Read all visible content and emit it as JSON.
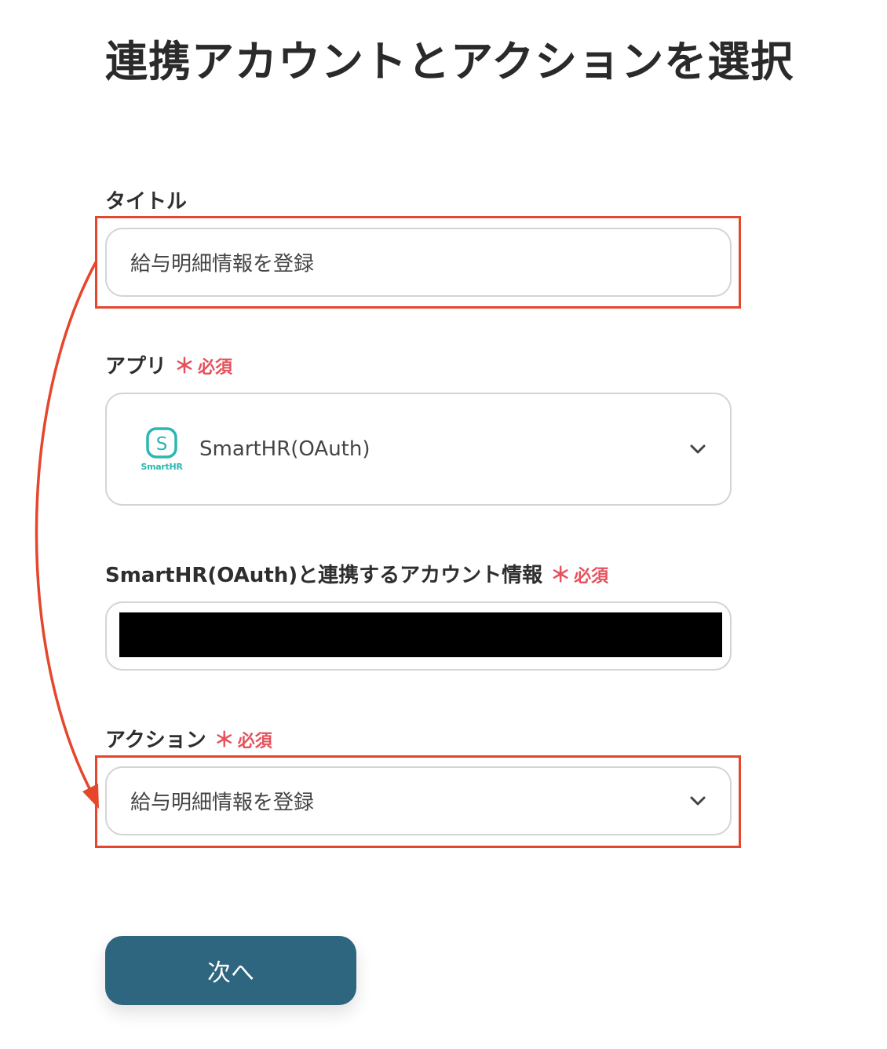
{
  "page": {
    "title": "連携アカウントとアクションを選択"
  },
  "required_marker": {
    "star": "＊",
    "text": "必須"
  },
  "form": {
    "title_field": {
      "label": "タイトル",
      "value": "給与明細情報を登録"
    },
    "app_field": {
      "label": "アプリ",
      "value": "SmartHR(OAuth)",
      "logo_text": "SmartHR",
      "logo_glyph": "S",
      "logo_icon": "smarthr-logo-icon"
    },
    "account_field": {
      "label": "SmartHR(OAuth)と連携するアカウント情報",
      "value_redacted": true
    },
    "action_field": {
      "label": "アクション",
      "value": "給与明細情報を登録"
    }
  },
  "buttons": {
    "next_label": "次へ"
  },
  "colors": {
    "highlight": "#e5462c",
    "required": "#e5525c",
    "button": "#2e667f",
    "logo": "#2cb7b0"
  }
}
